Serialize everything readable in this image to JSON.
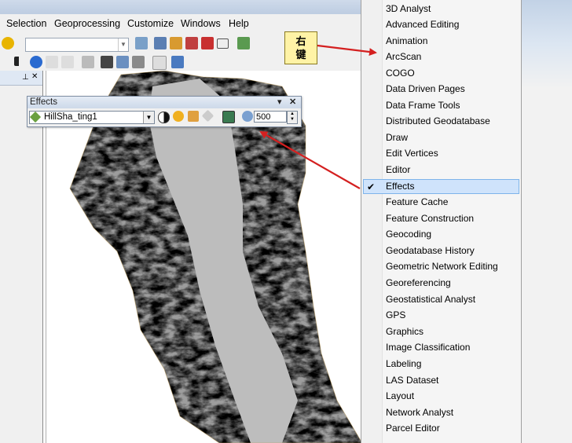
{
  "menubar": {
    "items": [
      "Selection",
      "Geoprocessing",
      "Customize",
      "Windows",
      "Help"
    ]
  },
  "effects_toolbar": {
    "title": "Effects",
    "pin_label": "▾",
    "close_label": "✕",
    "layer_value": "HillSha_ting1",
    "number_value": "500"
  },
  "callout": {
    "line1": "右",
    "line2": "键"
  },
  "toolbar_menu": {
    "items": [
      "3D Analyst",
      "Advanced Editing",
      "Animation",
      "ArcScan",
      "COGO",
      "Data Driven Pages",
      "Data Frame Tools",
      "Distributed Geodatabase",
      "Draw",
      "Edit Vertices",
      "Editor",
      "Effects",
      "Feature Cache",
      "Feature Construction",
      "Geocoding",
      "Geodatabase History",
      "Geometric Network Editing",
      "Georeferencing",
      "Geostatistical Analyst",
      "GPS",
      "Graphics",
      "Image Classification",
      "Labeling",
      "LAS Dataset",
      "Layout",
      "Network Analyst",
      "Parcel Editor"
    ],
    "checked_item": "Effects",
    "check_mark": "✔"
  },
  "colors": {
    "menu_highlight": "#cfe3fb",
    "arrow": "#d42020",
    "callout_bg": "#fff3a6"
  }
}
